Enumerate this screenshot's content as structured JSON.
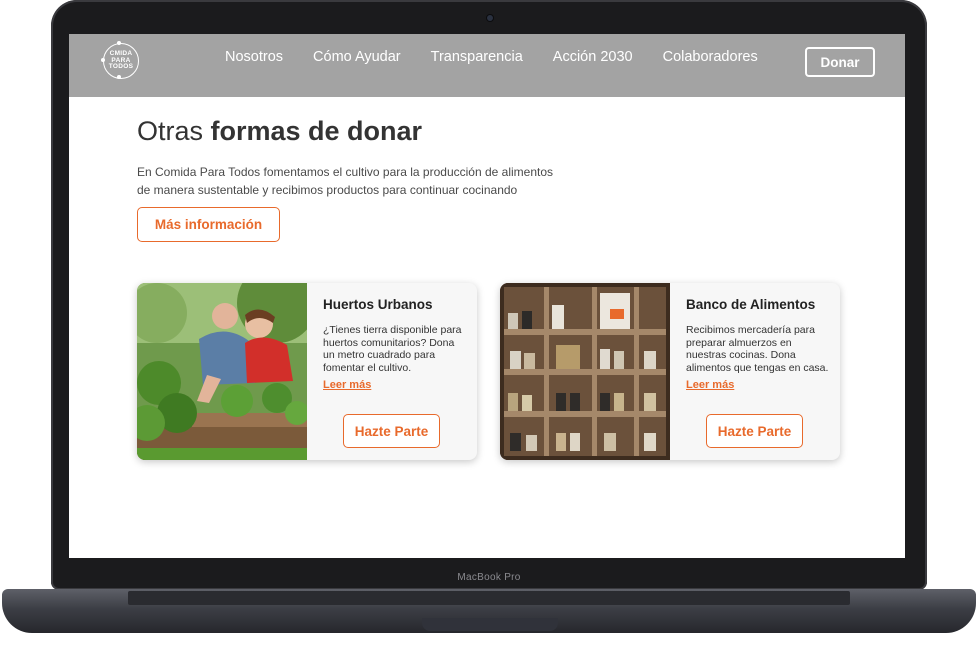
{
  "device": {
    "label": "MacBook Pro"
  },
  "header": {
    "logo_text": [
      "CMIDA",
      "PARA",
      "TODOS"
    ],
    "nav": [
      {
        "label": "Nosotros"
      },
      {
        "label": "Cómo Ayudar"
      },
      {
        "label": "Transparencia"
      },
      {
        "label": "Acción 2030"
      },
      {
        "label": "Colaboradores"
      }
    ],
    "donate_label": "Donar"
  },
  "main": {
    "title_light": "Otras ",
    "title_bold": "formas de donar",
    "lead": "En Comida Para Todos fomentamos el cultivo para la producción de alimentos de manera sustentable y recibimos productos para continuar cocinando",
    "more_info_label": "Más información"
  },
  "cards": [
    {
      "title": "Huertos Urbanos",
      "text": "¿Tienes tierra disponible para huertos comunitarios? Dona un metro cuadrado para fomentar el cultivo.",
      "link": "Leer más",
      "button": "Hazte Parte"
    },
    {
      "title": "Banco de Alimentos",
      "text": "Recibimos mercadería para preparar almuerzos en nuestras cocinas. Dona alimentos que tengas en casa.",
      "link": "Leer más",
      "button": "Hazte Parte"
    }
  ],
  "colors": {
    "nav_bg": "#a3a3a3",
    "accent": "#e86a2c",
    "card_bg": "#f7f7f7",
    "bezel": "#1b1b1d"
  },
  "icons": [
    "logo-circle-icon",
    "camera-icon"
  ]
}
